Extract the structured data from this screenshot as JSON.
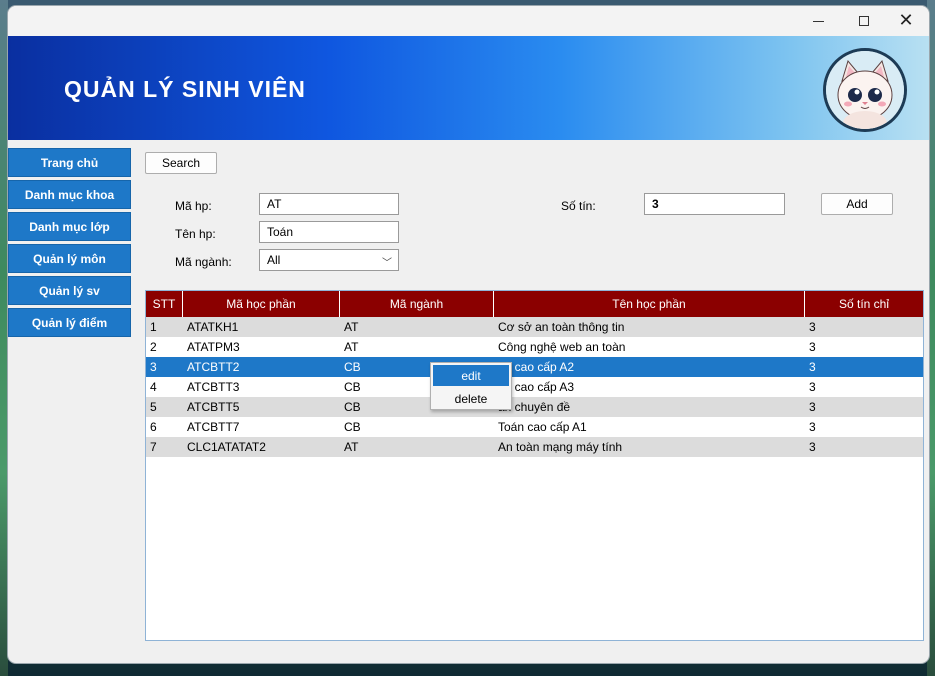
{
  "window": {
    "controls": {
      "minimize": "minimize-icon",
      "maximize": "maximize-icon",
      "close": "close-icon"
    }
  },
  "header": {
    "title": "QUẢN LÝ SINH VIÊN",
    "gradient_start": "#0a2fa0",
    "gradient_end": "#b8e0f2"
  },
  "sidebar": {
    "accent": "#1e78c8",
    "items": [
      {
        "label": "Trang chủ"
      },
      {
        "label": "Danh mục khoa"
      },
      {
        "label": "Danh mục lớp"
      },
      {
        "label": "Quản lý môn"
      },
      {
        "label": "Quản lý sv"
      },
      {
        "label": "Quản lý điểm"
      }
    ]
  },
  "form": {
    "search_label": "Search",
    "add_label": "Add",
    "ma_hp_label": "Mã hp:",
    "ma_hp_value": "AT",
    "ten_hp_label": "Tên hp:",
    "ten_hp_value": "Toán",
    "ma_nganh_label": "Mã ngành:",
    "ma_nganh_value": "All",
    "so_tin_label": "Số tín:",
    "so_tin_value": "3"
  },
  "table": {
    "header_color": "#8b0000",
    "selected_color": "#1e78c8",
    "columns": [
      "STT",
      "Mã học phần",
      "Mã ngành",
      "Tên học phần",
      "Số tín chỉ"
    ],
    "rows": [
      [
        "1",
        "ATATKH1",
        "AT",
        "Cơ sở an toàn thông tin",
        "3"
      ],
      [
        "2",
        "ATATPM3",
        "AT",
        "Công nghệ web an toàn",
        "3"
      ],
      [
        "3",
        "ATCBTT2",
        "CB",
        "án cao cấp A2",
        "3"
      ],
      [
        "4",
        "ATCBTT3",
        "CB",
        "án cao cấp A3",
        "3"
      ],
      [
        "5",
        "ATCBTT5",
        "CB",
        "án chuyên đề",
        "3"
      ],
      [
        "6",
        "ATCBTT7",
        "CB",
        "Toán cao cấp A1",
        "3"
      ],
      [
        "7",
        "CLC1ATATAT2",
        "AT",
        "An toàn mạng máy tính",
        "3"
      ]
    ],
    "selected_row": 3
  },
  "context_menu": {
    "items": [
      {
        "label": "edit"
      },
      {
        "label": "delete"
      }
    ]
  }
}
